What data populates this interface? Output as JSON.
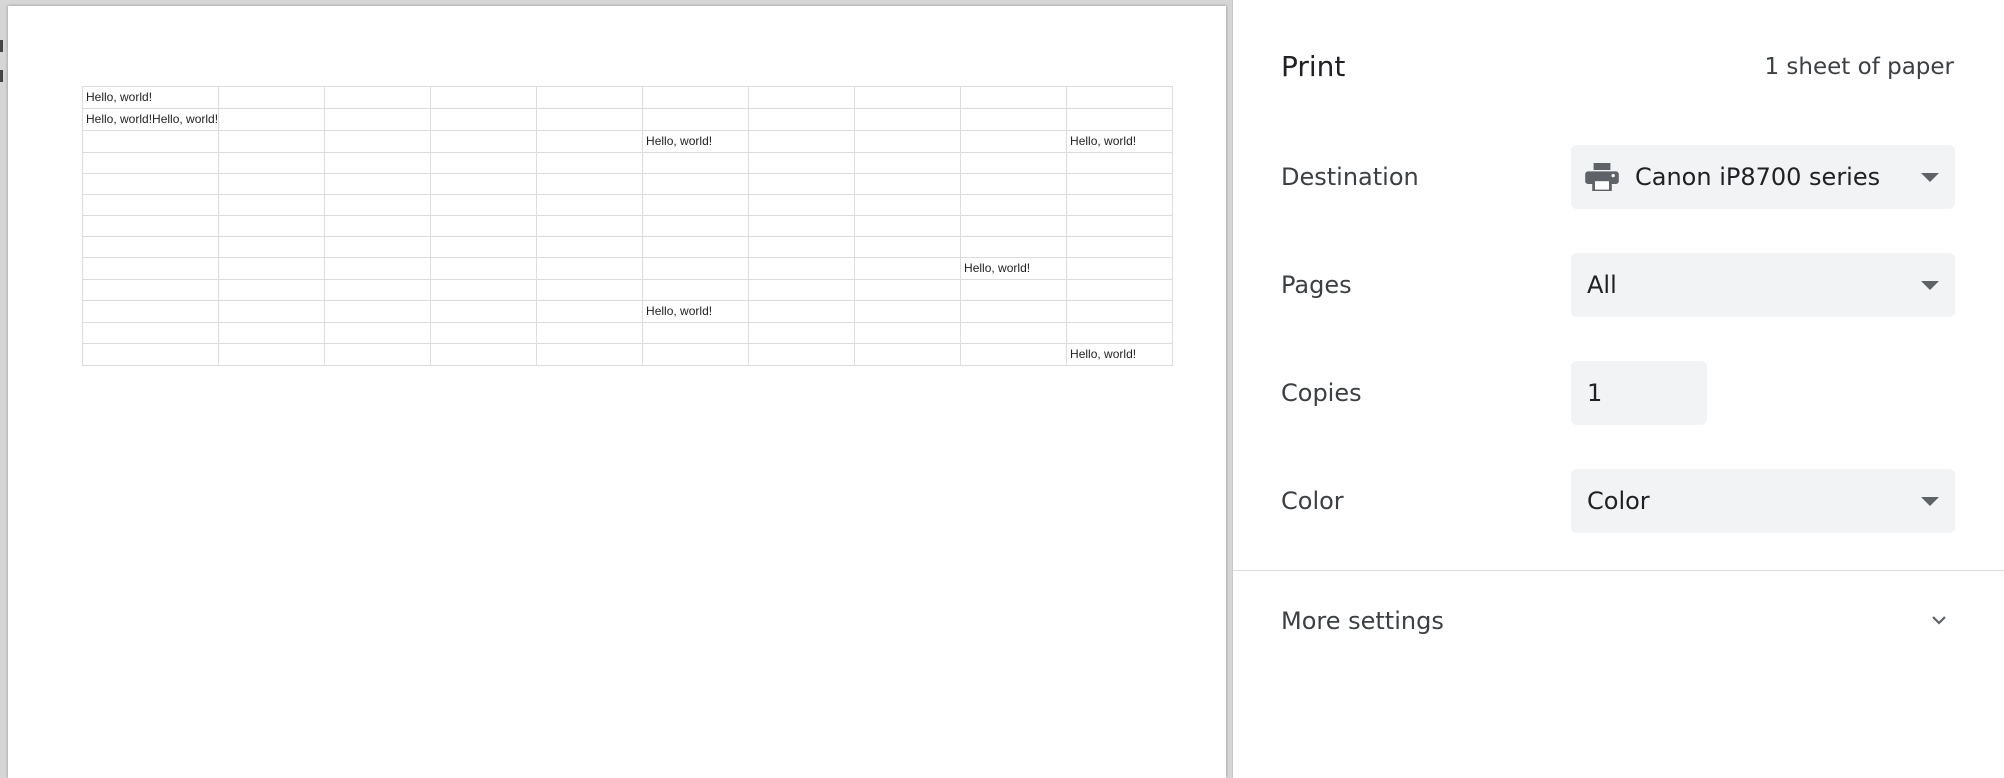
{
  "preview": {
    "grid": [
      [
        "Hello, world!",
        "",
        "",
        "",
        "",
        "",
        "",
        "",
        "",
        ""
      ],
      [
        "Hello, world!Hello, world!",
        "",
        "",
        "",
        "",
        "",
        "",
        "",
        "",
        ""
      ],
      [
        "",
        "",
        "",
        "",
        "",
        "Hello, world!",
        "",
        "",
        "",
        "Hello, world!"
      ],
      [
        "",
        "",
        "",
        "",
        "",
        "",
        "",
        "",
        "",
        ""
      ],
      [
        "",
        "",
        "",
        "",
        "",
        "",
        "",
        "",
        "",
        ""
      ],
      [
        "",
        "",
        "",
        "",
        "",
        "",
        "",
        "",
        "",
        ""
      ],
      [
        "",
        "",
        "",
        "",
        "",
        "",
        "",
        "",
        "",
        ""
      ],
      [
        "",
        "",
        "",
        "",
        "",
        "",
        "",
        "",
        "",
        ""
      ],
      [
        "",
        "",
        "",
        "",
        "",
        "",
        "",
        "",
        "Hello, world!",
        ""
      ],
      [
        "",
        "",
        "",
        "",
        "",
        "",
        "",
        "",
        "",
        ""
      ],
      [
        "",
        "",
        "",
        "",
        "",
        "Hello, world!",
        "",
        "",
        "",
        ""
      ],
      [
        "",
        "",
        "",
        "",
        "",
        "",
        "",
        "",
        "",
        ""
      ],
      [
        "",
        "",
        "",
        "",
        "",
        "",
        "",
        "",
        "",
        "Hello, world!"
      ]
    ]
  },
  "print_panel": {
    "title": "Print",
    "sheet_count": "1 sheet of paper",
    "destination": {
      "label": "Destination",
      "value": "Canon iP8700 series",
      "icon": "printer-icon"
    },
    "pages": {
      "label": "Pages",
      "value": "All"
    },
    "copies": {
      "label": "Copies",
      "value": "1"
    },
    "color": {
      "label": "Color",
      "value": "Color"
    },
    "more_settings": {
      "label": "More settings",
      "icon": "chevron-down-icon"
    }
  },
  "colors": {
    "field_background": "#f1f3f4",
    "text_primary": "#202124",
    "text_secondary": "#3c4043",
    "icon": "#5f6368"
  }
}
